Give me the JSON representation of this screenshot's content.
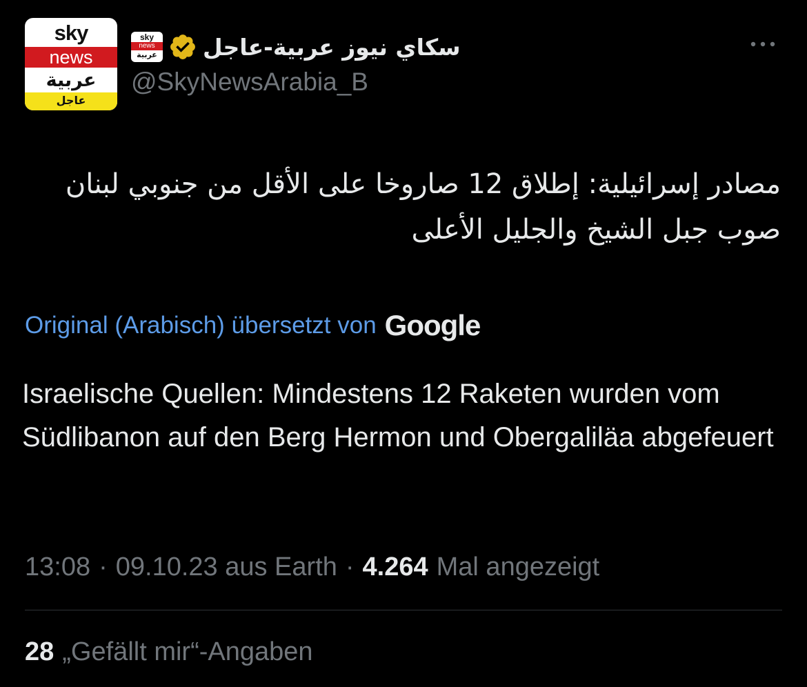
{
  "account": {
    "display_name": "سكاي نيوز عربية-عاجل",
    "handle": "@SkyNewsArabia_B",
    "verified": true,
    "badge_color": "#e2b719",
    "avatar": {
      "sky": "sky",
      "news": "news",
      "arabic": "عربية",
      "band": "عاجل",
      "news_red": "#d11a1f",
      "band_yellow": "#f5e11a"
    },
    "affiliate_logo": {
      "sky": "sky",
      "news": "news",
      "arabic": "عربية"
    }
  },
  "menu": {
    "icon": "more-horizontal-icon"
  },
  "tweet": {
    "text_arabic": "مصادر إسرائيلية: إطلاق 12 صاروخا على الأقل من جنوبي لبنان صوب جبل الشيخ والجليل الأعلى",
    "translation_label": "Original (Arabisch) übersetzt von",
    "translation_provider": "Google",
    "text_translated": "Israelische Quellen: Mindestens 12 Raketen wurden vom Südlibanon auf den Berg Hermon und Obergaliläa abgefeuert"
  },
  "meta": {
    "time": "13:08",
    "date": "09.10.23",
    "source": "aus Earth",
    "separator": "·",
    "views_count": "4.264",
    "views_label": "Mal angezeigt"
  },
  "stats": {
    "likes_count": "28",
    "likes_label": "„Gefällt mir“-Angaben"
  },
  "colors": {
    "background": "#000000",
    "primary_text": "#e7e9ea",
    "secondary_text": "#71767b",
    "link": "#5d9ce8",
    "divider": "#2f3336"
  }
}
